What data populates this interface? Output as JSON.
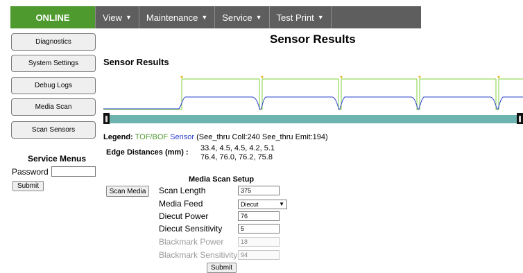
{
  "header": {
    "status": "ONLINE",
    "nav": [
      {
        "label": "View"
      },
      {
        "label": "Maintenance"
      },
      {
        "label": "Service"
      },
      {
        "label": "Test Print"
      }
    ]
  },
  "sidebar": {
    "buttons": [
      "Diagnostics",
      "System Settings",
      "Debug Logs",
      "Media Scan",
      "Scan Sensors"
    ],
    "service_title": "Service Menus",
    "password_label": "Password",
    "password_value": "",
    "submit_label": "Submit"
  },
  "main": {
    "page_title": "Sensor Results",
    "section_title": "Sensor Results",
    "legend": {
      "label": "Legend:",
      "tofbof": "TOF/BOF",
      "sensor": "Sensor",
      "details": "(See_thru Coll:240 See_thru Emit:194)"
    },
    "edge": {
      "label": "Edge Distances (mm) :",
      "line1": "33.4, 4.5, 4.5, 4.2, 5.1",
      "line2": "76.4, 76.0, 76.2, 75.8"
    },
    "scan_button": "Scan Media",
    "setup": {
      "title": "Media Scan Setup",
      "scan_length_label": "Scan Length",
      "scan_length_value": "375",
      "media_feed_label": "Media Feed",
      "media_feed_value": "Diecut",
      "diecut_power_label": "Diecut Power",
      "diecut_power_value": "76",
      "diecut_sens_label": "Diecut Sensitivity",
      "diecut_sens_value": "5",
      "black_power_label": "Blackmark Power",
      "black_power_value": "18",
      "black_sens_label": "Blackmark Sensitivity",
      "black_sens_value": "94",
      "submit_label": "Submit"
    }
  },
  "colors": {
    "status_green": "#4f9a2f",
    "nav_gray": "#5e5e5e",
    "tofbof_line": "#7fd13b",
    "sensor_line": "#2a3fcc",
    "slider": "#6db3b0"
  }
}
